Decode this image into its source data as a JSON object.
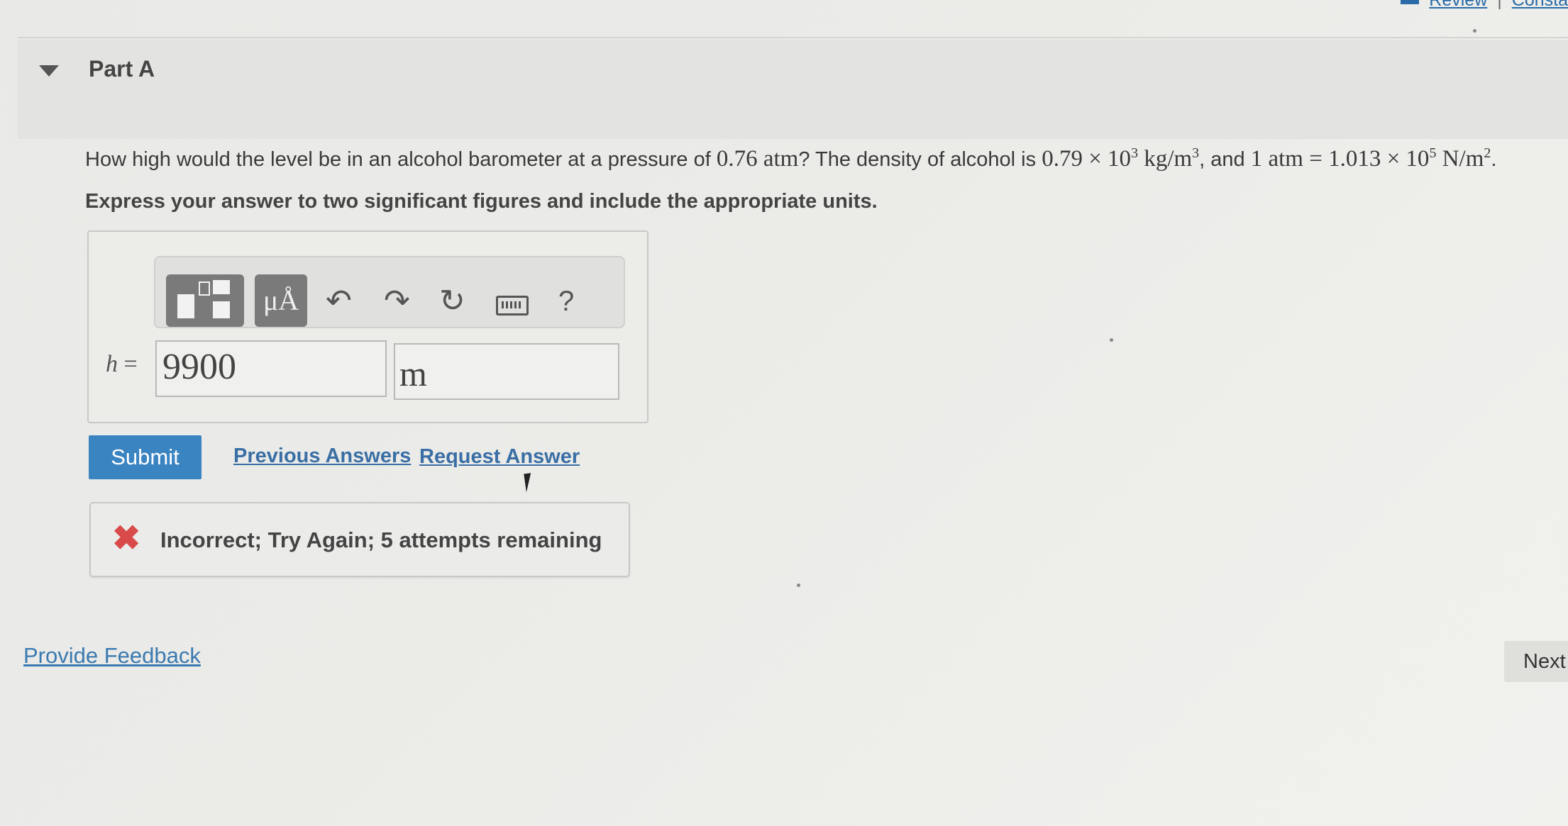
{
  "top_nav": {
    "review": "Review",
    "separator": "|",
    "constants": "Consta"
  },
  "part": {
    "title": "Part A"
  },
  "question": {
    "text_1": "How high would the level be in an alcohol barometer at a pressure of ",
    "pressure": "0.76 atm",
    "text_2": "? The density of alcohol is ",
    "density_coeff": "0.79 × 10",
    "density_exp": "3",
    "density_unit": " kg/m",
    "density_unit_exp": "3",
    "text_3": ", and ",
    "atm_coeff": "1 atm = 1.013 × 10",
    "atm_exp": "5",
    "atm_unit": " N/m",
    "atm_unit_exp": "2",
    "text_4": "."
  },
  "instruction": "Express your answer to two significant figures and include the appropriate units.",
  "toolbar": {
    "units_label": "μÅ",
    "undo": "↶",
    "redo": "↷",
    "reset": "↻",
    "help": "?"
  },
  "answer": {
    "variable": "h",
    "equals": "=",
    "value": "9900",
    "unit": "m"
  },
  "actions": {
    "submit": "Submit",
    "previous_answers": "Previous Answers",
    "request_answer": "Request Answer"
  },
  "feedback": {
    "icon": "✖",
    "message": "Incorrect; Try Again; 5 attempts remaining"
  },
  "footer": {
    "provide_feedback": "Provide Feedback",
    "next": "Next"
  },
  "colors": {
    "accent": "#3a84c1",
    "link": "#3a6fa5",
    "error": "#d94a4a"
  }
}
